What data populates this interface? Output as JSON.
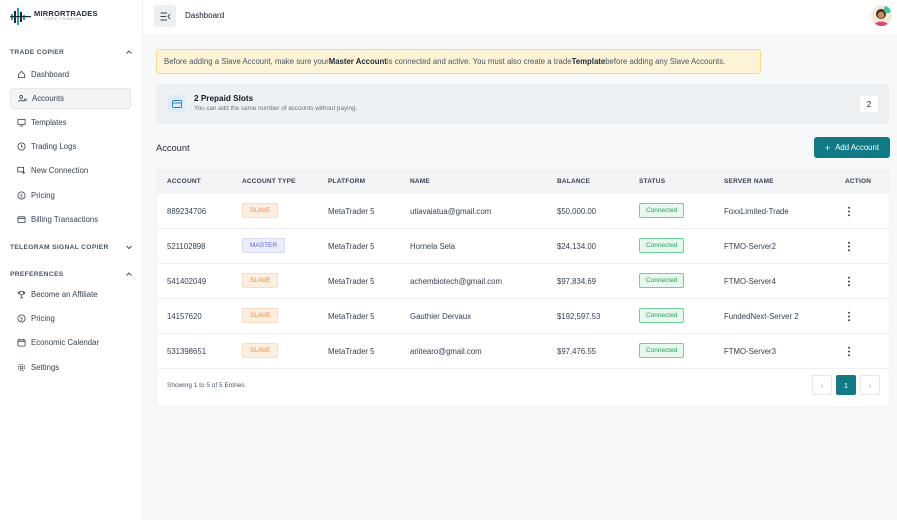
{
  "app": {
    "logo_title": "MIRRORTRADES",
    "logo_subtitle": "COPY TRADING"
  },
  "sidebar": {
    "sections": [
      {
        "title": "TRADE COPIER",
        "expanded": true,
        "items": [
          {
            "label": "Dashboard",
            "icon": "home-icon"
          },
          {
            "label": "Accounts",
            "icon": "user-link-icon",
            "active": true
          },
          {
            "label": "Templates",
            "icon": "monitor-icon"
          },
          {
            "label": "Trading Logs",
            "icon": "clock-icon"
          },
          {
            "label": "New Connection",
            "icon": "link-device-icon"
          },
          {
            "label": "Pricing",
            "icon": "dollar-circle-icon"
          },
          {
            "label": "Billing Transactions",
            "icon": "wallet-icon"
          }
        ]
      },
      {
        "title": "TELEGRAM SIGNAL COPIER",
        "expanded": false,
        "items": []
      },
      {
        "title": "PREFERENCES",
        "expanded": true,
        "items": [
          {
            "label": "Become an Affiliate",
            "icon": "trophy-icon"
          },
          {
            "label": "Pricing",
            "icon": "dollar-circle-icon"
          },
          {
            "label": "Economic Calendar",
            "icon": "calendar-icon"
          },
          {
            "label": "Settings",
            "icon": "gear-icon"
          }
        ]
      }
    ]
  },
  "topbar": {
    "breadcrumb": "Dashboard"
  },
  "alert": {
    "part1": "Before adding a Slave Account, make sure your ",
    "bold1": "Master Account",
    "part2": " is connected and active. You must also create a trade ",
    "bold2": "Template",
    "part3": " before adding any Slave Accounts."
  },
  "slots": {
    "title": "2 Prepaid Slots",
    "subtitle": "You can add the same number of accounts without paying.",
    "count": "2"
  },
  "accounts": {
    "title": "Account",
    "add_label": "Add Account",
    "columns": [
      "ACCOUNT",
      "ACCOUNT TYPE",
      "PLATFORM",
      "NAME",
      "BALANCE",
      "STATUS",
      "SERVER NAME",
      "ACTION"
    ],
    "rows": [
      {
        "account": "889234706",
        "type": "SLAVE",
        "platform": "MetaTrader 5",
        "name": "utiavaiatua@gmail.com",
        "balance": "$50,000.00",
        "status": "Connected",
        "server": "FoxxLimited-Trade"
      },
      {
        "account": "521102898",
        "type": "MASTER",
        "platform": "MetaTrader 5",
        "name": "Hornela Sela",
        "balance": "$24,134.00",
        "status": "Connected",
        "server": "FTMO-Server2"
      },
      {
        "account": "541402049",
        "type": "SLAVE",
        "platform": "MetaTrader 5",
        "name": "achembiotech@gmail.com",
        "balance": "$97,834.69",
        "status": "Connected",
        "server": "FTMO-Server4"
      },
      {
        "account": "14157620",
        "type": "SLAVE",
        "platform": "MetaTrader 5",
        "name": "Gauthier Dervaux",
        "balance": "$192,597.53",
        "status": "Connected",
        "server": "FundedNext-Server 2"
      },
      {
        "account": "531398651",
        "type": "SLAVE",
        "platform": "MetaTrader 5",
        "name": "ariitearo@gmail.com",
        "balance": "$97,476.55",
        "status": "Connected",
        "server": "FTMO-Server3"
      }
    ],
    "footer": "Showing 1 to 5 of 5 Entries",
    "pager": {
      "prev": "‹",
      "current": "1",
      "next": "›"
    }
  },
  "colors": {
    "accent": "#117a84",
    "alert_bg": "#fdf4d8",
    "slave": "#f08a3c",
    "master": "#5b5fd6",
    "connected": "#1f9d55"
  }
}
